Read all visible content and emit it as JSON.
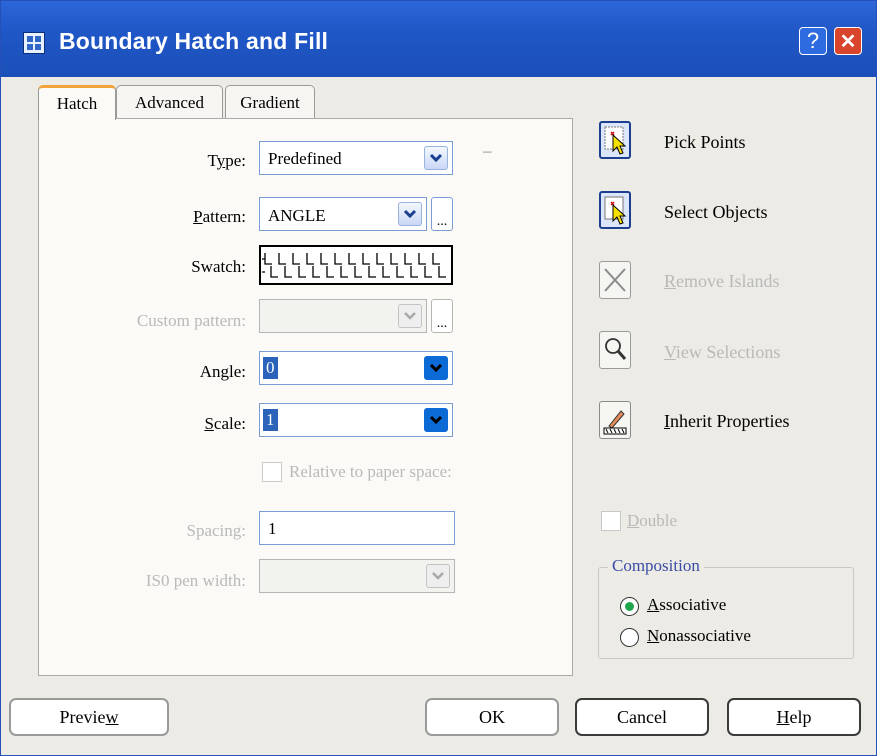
{
  "window": {
    "title": "Boundary Hatch and Fill"
  },
  "titlebar_buttons": {
    "help": "?",
    "close": "✕"
  },
  "tabs": [
    {
      "label": "Hatch",
      "active": true
    },
    {
      "label": "Advanced",
      "active": false
    },
    {
      "label": "Gradient",
      "active": false
    }
  ],
  "hatch": {
    "type": {
      "label_pre": "T",
      "label_u": "y",
      "label_post": "pe:",
      "value": "Predefined"
    },
    "pattern": {
      "label_u": "P",
      "label_post": "attern:",
      "value": "ANGLE",
      "ellipsis": "..."
    },
    "swatch": {
      "label": "Swatch:"
    },
    "custom_pattern": {
      "label": "Custom pattern:",
      "value": "",
      "ellipsis": "..."
    },
    "angle": {
      "label": "Angle:",
      "value": "0"
    },
    "scale": {
      "label_u": "S",
      "label_post": "cale:",
      "value": "1"
    },
    "relative": {
      "label": "Relative to paper space:",
      "checked": false
    },
    "spacing": {
      "label": "Spacing:",
      "value": "1"
    },
    "iso_pen": {
      "label": "IS0 pen width:",
      "value": ""
    },
    "dash": "–"
  },
  "actions": {
    "pick_points": "Pick Points",
    "select_objects": "Select Objects",
    "remove_islands": {
      "u": "R",
      "rest": "emove Islands"
    },
    "view_selections": {
      "u": "V",
      "rest": "iew Selections"
    },
    "inherit_properties": {
      "u": "I",
      "rest": "nherit Properties"
    }
  },
  "double": {
    "u": "D",
    "rest": "ouble",
    "checked": false
  },
  "composition": {
    "title": "Composition",
    "associative": {
      "u": "A",
      "rest": "ssociative",
      "selected": true
    },
    "nonassociative": {
      "u": "N",
      "rest": "onassociative",
      "selected": false
    }
  },
  "buttons": {
    "preview": {
      "pre": "Previe",
      "u": "w"
    },
    "ok": "OK",
    "cancel": "Cancel",
    "help": {
      "u": "H",
      "rest": "elp"
    }
  },
  "colors": {
    "titlebar": "#1f57c7",
    "accent": "#0b6ad6",
    "tab_highlight": "#f0a43a",
    "radio_dot": "#1fa54b"
  }
}
